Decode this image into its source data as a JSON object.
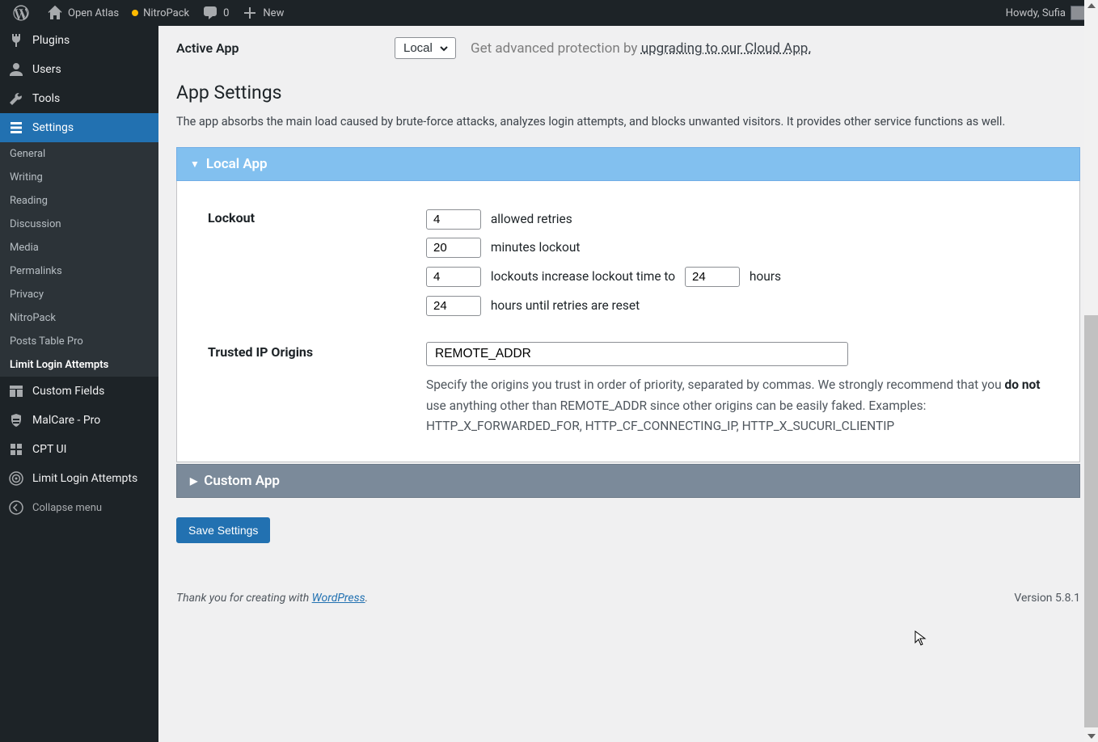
{
  "topbar": {
    "site_name": "Open Atlas",
    "nitropack": "NitroPack",
    "comments_count": "0",
    "new_label": "New",
    "greeting": "Howdy, Sufia"
  },
  "sidebar": {
    "items": [
      {
        "label": "Plugins",
        "icon": "plug"
      },
      {
        "label": "Users",
        "icon": "user"
      },
      {
        "label": "Tools",
        "icon": "wrench"
      },
      {
        "label": "Settings",
        "icon": "sliders",
        "active": true
      },
      {
        "label": "Custom Fields",
        "icon": "table"
      },
      {
        "label": "MalCare - Pro",
        "icon": "shield"
      },
      {
        "label": "CPT UI",
        "icon": "grid"
      },
      {
        "label": "Limit Login Attempts",
        "icon": "radar"
      }
    ],
    "submenu": [
      "General",
      "Writing",
      "Reading",
      "Discussion",
      "Media",
      "Permalinks",
      "Privacy",
      "NitroPack",
      "Posts Table Pro",
      "Limit Login Attempts"
    ],
    "submenu_current": "Limit Login Attempts",
    "collapse": "Collapse menu"
  },
  "content": {
    "active_app_label": "Active App",
    "active_app_select": "Local",
    "upgrade_prefix": "Get advanced protection by ",
    "upgrade_link": "upgrading to our Cloud App.",
    "section_title": "App Settings",
    "section_desc": "The app absorbs the main load caused by brute-force attacks, analyzes login attempts, and blocks unwanted visitors. It provides other service functions as well.",
    "local_app_title": "Local App",
    "lockout_label": "Lockout",
    "allowed_retries": "4",
    "allowed_retries_text": "allowed retries",
    "minutes_lockout": "20",
    "minutes_lockout_text": "minutes lockout",
    "lockouts_increase": "4",
    "lockouts_increase_text": "lockouts increase lockout time to",
    "lockouts_increase_hours": "24",
    "lockouts_increase_hours_text": "hours",
    "hours_reset": "24",
    "hours_reset_text": "hours until retries are reset",
    "trusted_ip_label": "Trusted IP Origins",
    "trusted_ip_value": "REMOTE_ADDR",
    "trusted_ip_help_1": "Specify the origins you trust in order of priority, separated by commas. We strongly recommend that you ",
    "trusted_ip_help_strong": "do not",
    "trusted_ip_help_2": " use anything other than REMOTE_ADDR since other origins can be easily faked. Examples: HTTP_X_FORWARDED_FOR, HTTP_CF_CONNECTING_IP, HTTP_X_SUCURI_CLIENTIP",
    "custom_app_title": "Custom App",
    "save_button": "Save Settings",
    "footer_text": "Thank you for creating with ",
    "footer_link": "WordPress",
    "footer_period": ".",
    "version": "Version 5.8.1"
  }
}
